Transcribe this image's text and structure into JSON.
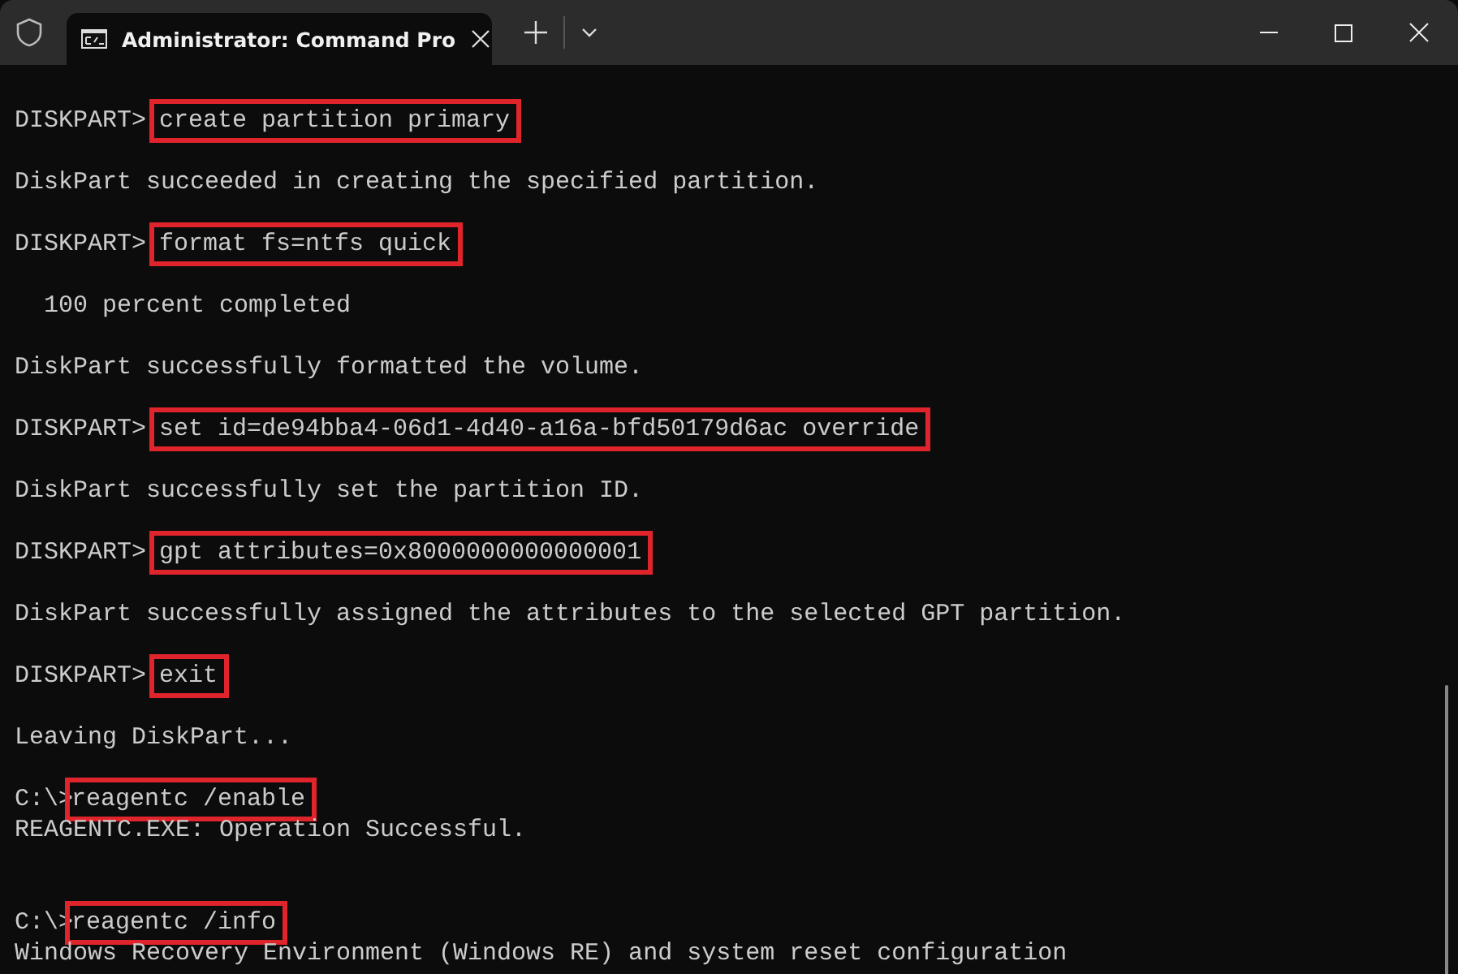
{
  "window": {
    "tab_title": "Administrator: Command Pro"
  },
  "lines": [
    {
      "kind": "prompt",
      "prompt": "DISKPART>",
      "command": "create partition primary"
    },
    {
      "kind": "blank"
    },
    {
      "kind": "output",
      "text": "DiskPart succeeded in creating the specified partition."
    },
    {
      "kind": "blank"
    },
    {
      "kind": "prompt",
      "prompt": "DISKPART>",
      "command": "format fs=ntfs quick"
    },
    {
      "kind": "blank"
    },
    {
      "kind": "output",
      "text": "  100 percent completed"
    },
    {
      "kind": "blank"
    },
    {
      "kind": "output",
      "text": "DiskPart successfully formatted the volume."
    },
    {
      "kind": "blank"
    },
    {
      "kind": "prompt",
      "prompt": "DISKPART>",
      "command": "set id=de94bba4-06d1-4d40-a16a-bfd50179d6ac override"
    },
    {
      "kind": "blank"
    },
    {
      "kind": "output",
      "text": "DiskPart successfully set the partition ID."
    },
    {
      "kind": "blank"
    },
    {
      "kind": "prompt",
      "prompt": "DISKPART>",
      "command": "gpt attributes=0x8000000000000001"
    },
    {
      "kind": "blank"
    },
    {
      "kind": "output",
      "text": "DiskPart successfully assigned the attributes to the selected GPT partition."
    },
    {
      "kind": "blank"
    },
    {
      "kind": "prompt",
      "prompt": "DISKPART>",
      "command": "exit"
    },
    {
      "kind": "blank"
    },
    {
      "kind": "output",
      "text": "Leaving DiskPart..."
    },
    {
      "kind": "blank"
    },
    {
      "kind": "prompt",
      "prompt": "C:\\>",
      "command": "reagentc /enable"
    },
    {
      "kind": "output",
      "text": "REAGENTC.EXE: Operation Successful."
    },
    {
      "kind": "blank"
    },
    {
      "kind": "blank"
    },
    {
      "kind": "prompt",
      "prompt": "C:\\>",
      "command": "reagentc /info"
    },
    {
      "kind": "output",
      "text": "Windows Recovery Environment (Windows RE) and system reset configuration"
    }
  ]
}
